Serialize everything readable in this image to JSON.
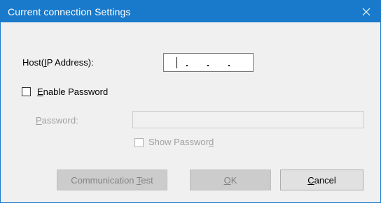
{
  "dialog": {
    "title": "Current connection Settings",
    "close_icon": "close-icon"
  },
  "host": {
    "label_prefix": "Host(",
    "label_accel": "I",
    "label_suffix": "P Address):",
    "ip_value": ". . ."
  },
  "enable_password": {
    "checked": false,
    "label_accel": "E",
    "label_rest": "nable Password"
  },
  "password": {
    "label_accel": "P",
    "label_rest": "assword:",
    "value": "",
    "enabled": false
  },
  "show_password": {
    "checked": false,
    "enabled": false,
    "label_main": "Show Passwor",
    "label_accel": "d"
  },
  "buttons": {
    "test": {
      "label_main": "Communication ",
      "label_accel": "T",
      "label_rest": "est",
      "enabled": false
    },
    "ok": {
      "label_accel": "O",
      "label_rest": "K",
      "enabled": false
    },
    "cancel": {
      "label_accel": "C",
      "label_rest": "ancel",
      "enabled": true
    }
  },
  "colors": {
    "titlebar": "#1979ca",
    "dialog_bg": "#f0f0f0",
    "disabled_text": "#a0a0a0"
  }
}
